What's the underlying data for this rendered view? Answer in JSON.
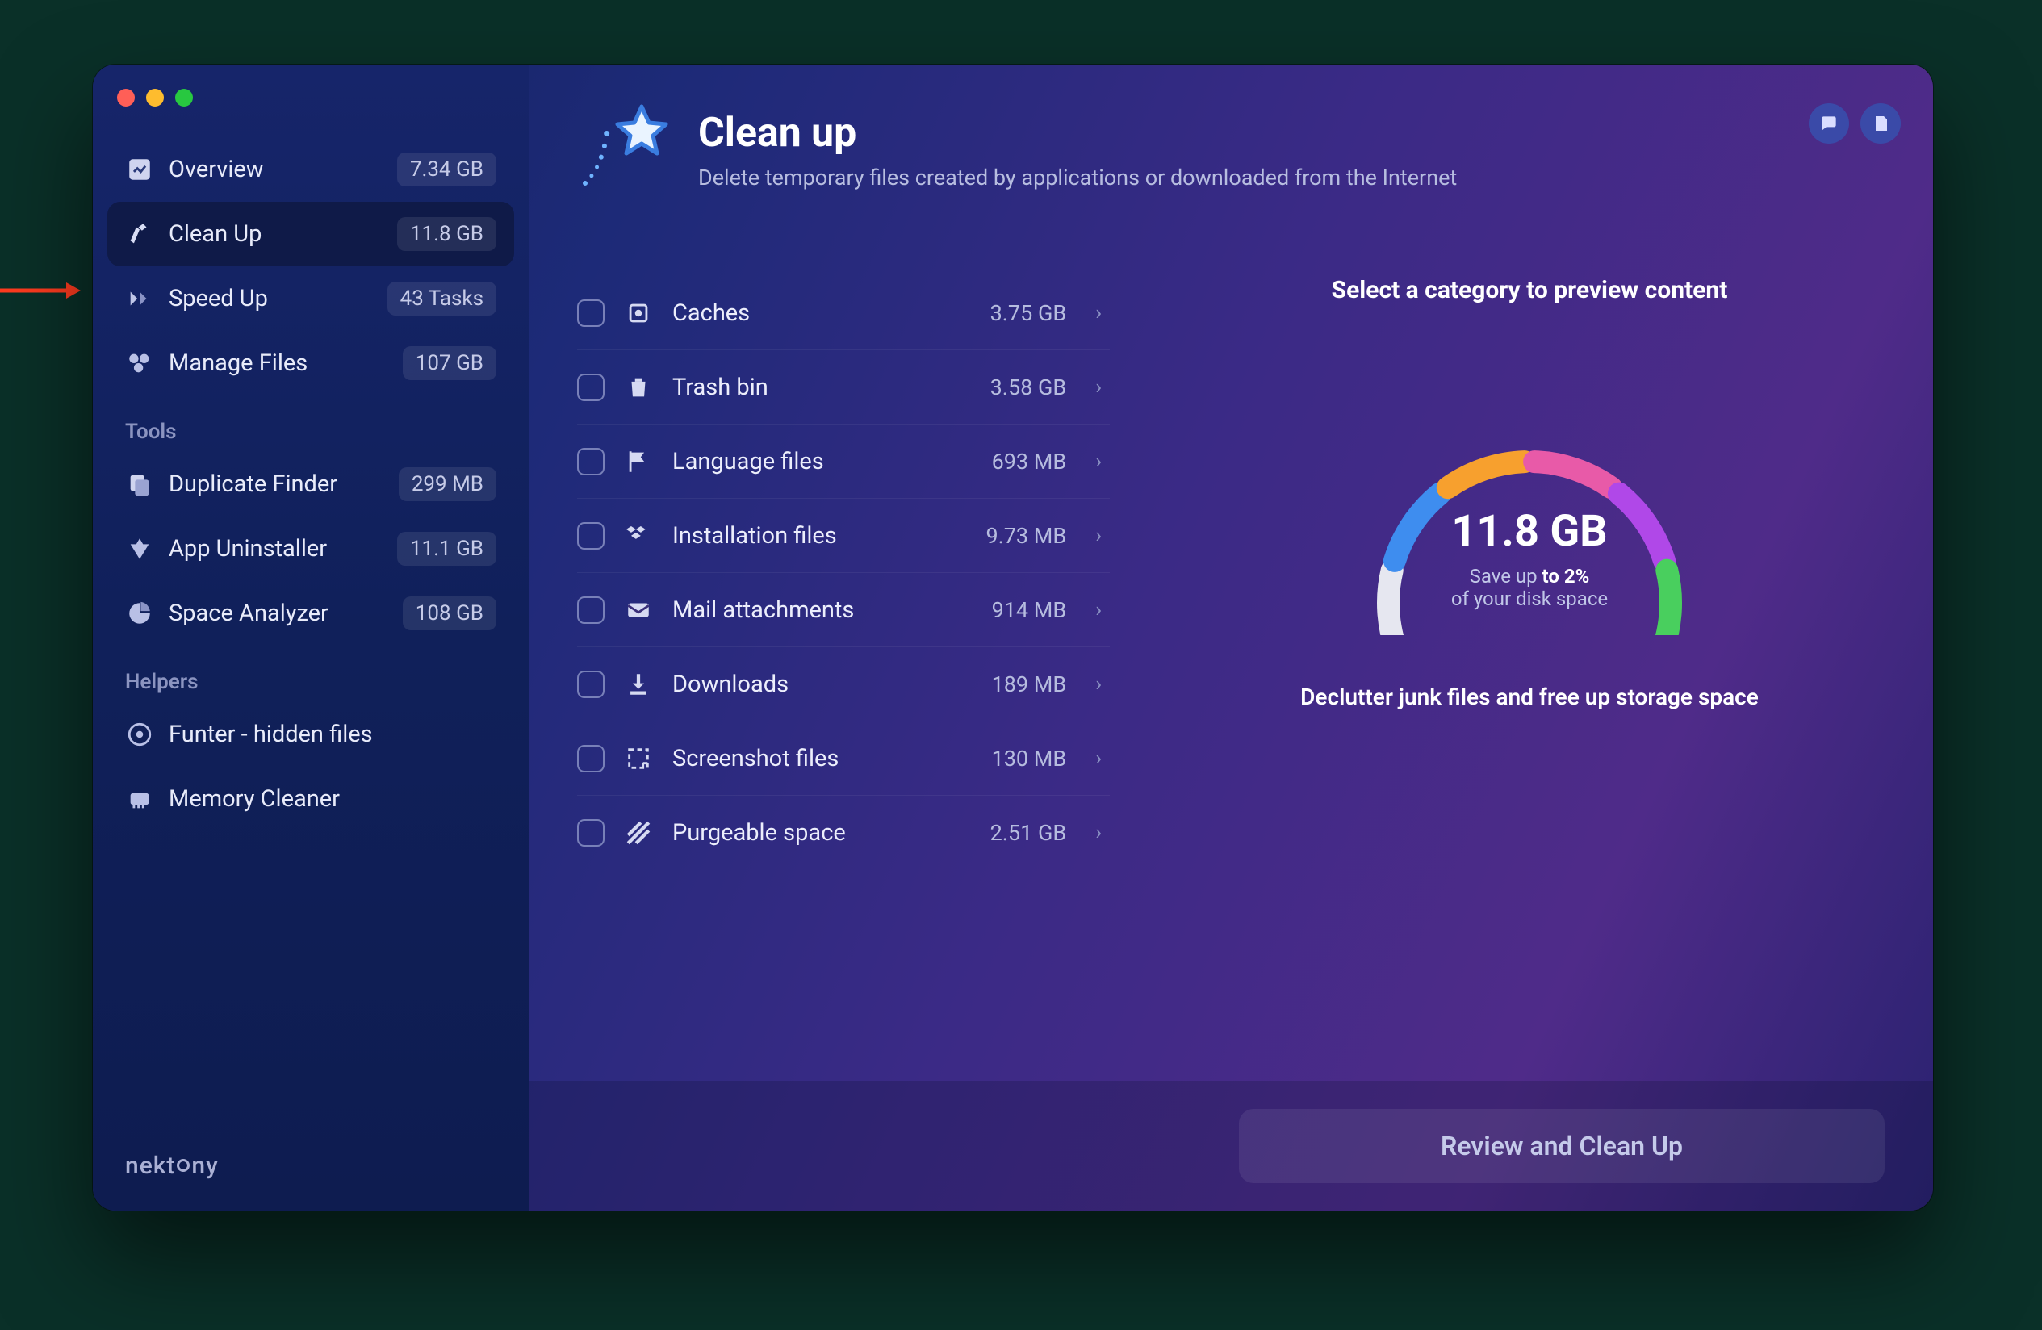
{
  "pointer": {
    "visible": true
  },
  "sidebar": {
    "nav": [
      {
        "icon": "overview-icon",
        "label": "Overview",
        "badge": "7.34 GB",
        "active": false
      },
      {
        "icon": "cleanup-icon",
        "label": "Clean Up",
        "badge": "11.8 GB",
        "active": true
      },
      {
        "icon": "speedup-icon",
        "label": "Speed Up",
        "badge": "43 Tasks",
        "active": false
      },
      {
        "icon": "manage-icon",
        "label": "Manage Files",
        "badge": "107 GB",
        "active": false
      }
    ],
    "tools_title": "Tools",
    "tools": [
      {
        "icon": "duplicate-icon",
        "label": "Duplicate Finder",
        "badge": "299 MB"
      },
      {
        "icon": "uninstaller-icon",
        "label": "App Uninstaller",
        "badge": "11.1 GB"
      },
      {
        "icon": "analyzer-icon",
        "label": "Space Analyzer",
        "badge": "108 GB"
      }
    ],
    "helpers_title": "Helpers",
    "helpers": [
      {
        "icon": "funter-icon",
        "label": "Funter - hidden files",
        "badge": ""
      },
      {
        "icon": "memory-icon",
        "label": "Memory Cleaner",
        "badge": ""
      }
    ],
    "brand_prefix": "nekt",
    "brand_suffix": "ny"
  },
  "header": {
    "title": "Clean up",
    "subtitle": "Delete temporary files created by applications or downloaded from the Internet"
  },
  "categories": [
    {
      "icon": "cache-icon",
      "label": "Caches",
      "size": "3.75 GB"
    },
    {
      "icon": "trash-icon",
      "label": "Trash bin",
      "size": "3.58 GB"
    },
    {
      "icon": "flag-icon",
      "label": "Language files",
      "size": "693 MB"
    },
    {
      "icon": "dropbox-icon",
      "label": "Installation files",
      "size": "9.73 MB"
    },
    {
      "icon": "mail-icon",
      "label": "Mail attachments",
      "size": "914 MB"
    },
    {
      "icon": "download-icon",
      "label": "Downloads",
      "size": "189 MB"
    },
    {
      "icon": "screenshot-icon",
      "label": "Screenshot files",
      "size": "130 MB"
    },
    {
      "icon": "purge-icon",
      "label": "Purgeable space",
      "size": "2.51 GB"
    }
  ],
  "preview": {
    "title": "Select a category to preview content",
    "gauge_value": "11.8 GB",
    "gauge_line1_a": "Save up ",
    "gauge_line1_b": "to 2%",
    "gauge_line2": "of your disk space",
    "subtitle": "Declutter junk files and free up storage space",
    "segments": [
      {
        "color": "#e6e7f0"
      },
      {
        "color": "#3e8def"
      },
      {
        "color": "#f7a02e"
      },
      {
        "color": "#e85aa8"
      },
      {
        "color": "#b048e8"
      },
      {
        "color": "#49cf5e"
      }
    ]
  },
  "footer": {
    "button": "Review and Clean Up"
  }
}
